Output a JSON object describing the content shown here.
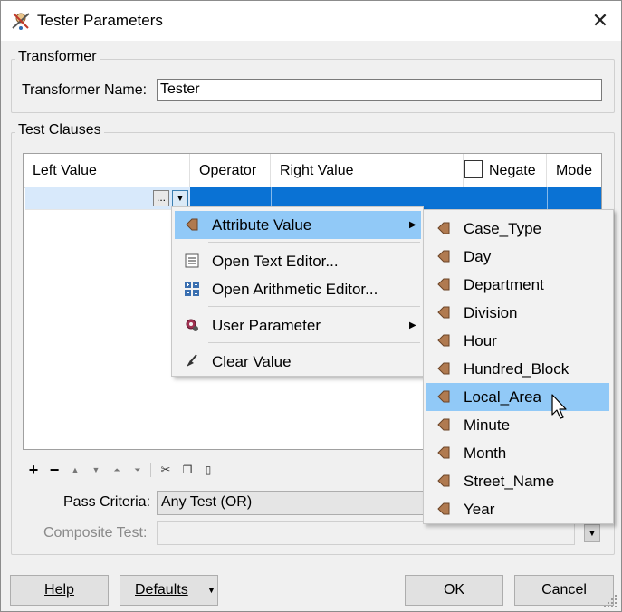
{
  "window": {
    "title": "Tester Parameters"
  },
  "transformer_group": {
    "legend": "Transformer",
    "name_label": "Transformer Name:",
    "name_value": "Tester"
  },
  "clauses_group": {
    "legend": "Test Clauses",
    "columns": {
      "left_value": "Left Value",
      "operator": "Operator",
      "right_value": "Right Value",
      "negate": "Negate",
      "mode": "Mode"
    },
    "row_button": "..."
  },
  "context_menu": {
    "items": [
      {
        "label": "Attribute Value",
        "icon": "attribute-icon",
        "submenu": true,
        "highlighted": true
      },
      {
        "label": "Open Text Editor...",
        "icon": "text-editor-icon"
      },
      {
        "label": "Open Arithmetic Editor...",
        "icon": "arithmetic-editor-icon"
      },
      {
        "label": "User Parameter",
        "icon": "user-parameter-icon",
        "submenu": true
      },
      {
        "label": "Clear Value",
        "icon": "broom-icon"
      }
    ]
  },
  "attribute_submenu": {
    "items": [
      "Case_Type",
      "Day",
      "Department",
      "Division",
      "Hour",
      "Hundred_Block",
      "Local_Area",
      "Minute",
      "Month",
      "Street_Name",
      "Year"
    ],
    "highlighted": "Local_Area"
  },
  "pass_criteria": {
    "label": "Pass Criteria:",
    "value": "Any Test (OR)"
  },
  "composite_test": {
    "label": "Composite Test:",
    "value": ""
  },
  "buttons": {
    "help": "Help",
    "defaults": "Defaults",
    "ok": "OK",
    "cancel": "Cancel"
  },
  "colors": {
    "selection": "#0a72d4",
    "menu_highlight": "#91c9f7",
    "attribute_icon": "#b07a50"
  }
}
